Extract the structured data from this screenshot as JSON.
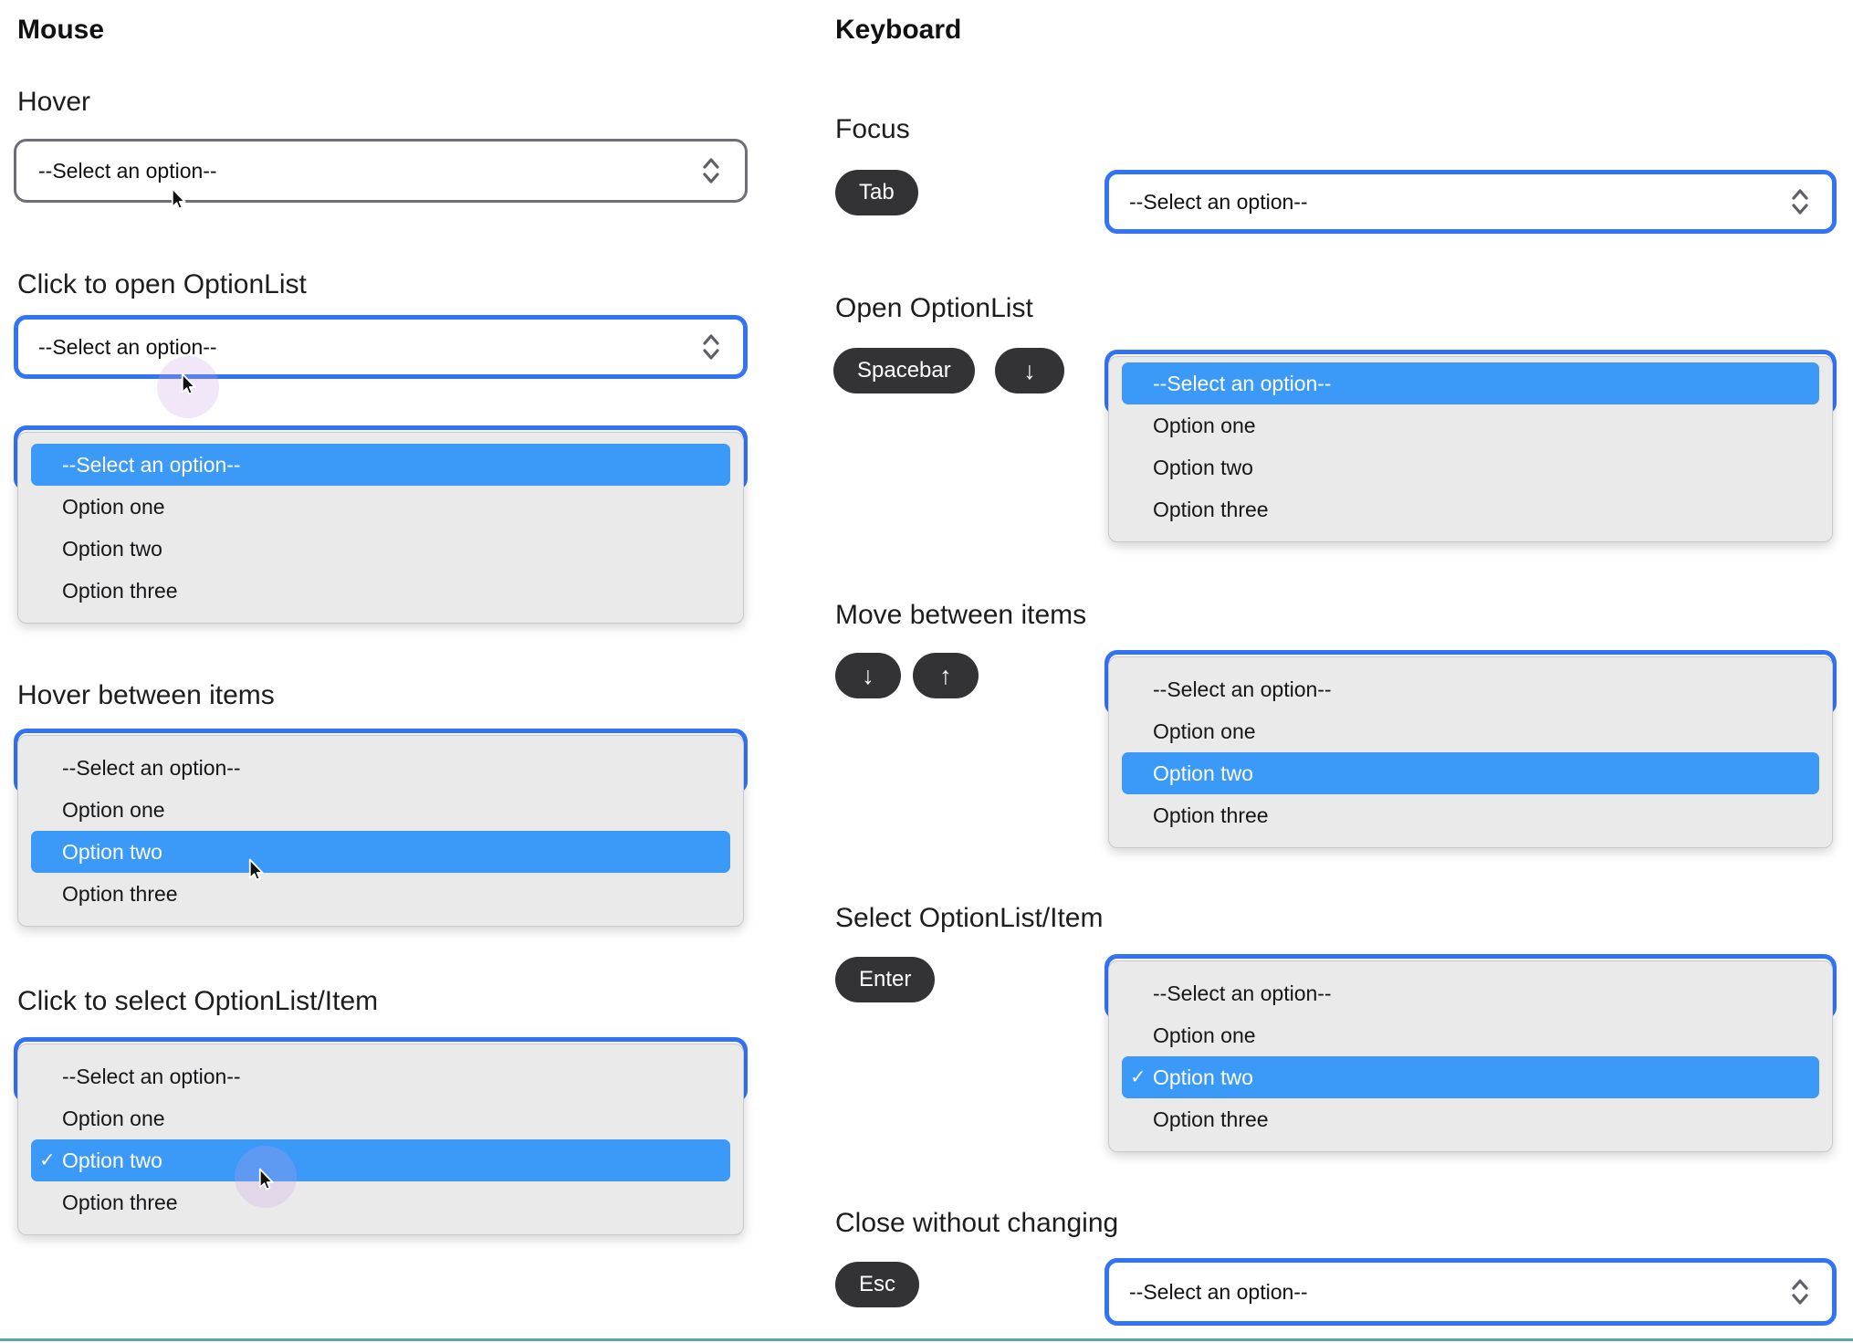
{
  "mouse": {
    "title": "Mouse",
    "hover_label": "Hover",
    "click_open_label": "Click to open OptionList",
    "hover_items_label": "Hover between items",
    "click_select_label": "Click to select OptionList/Item"
  },
  "keyboard": {
    "title": "Keyboard",
    "focus_label": "Focus",
    "open_label": "Open OptionList",
    "move_label": "Move between items",
    "select_label": "Select OptionList/Item",
    "close_label": "Close without changing",
    "keys": {
      "tab": "Tab",
      "spacebar": "Spacebar",
      "enter": "Enter",
      "esc": "Esc",
      "down_arrow": "↓",
      "up_arrow": "↑"
    }
  },
  "options": {
    "placeholder": "--Select an option--",
    "one": "Option one",
    "two": "Option two",
    "three": "Option three"
  },
  "icons": {
    "check": "✓",
    "select_chevron": "up-down-chevron-icon",
    "cursor": "mouse-pointer-icon"
  },
  "colors": {
    "focus_ring_blue": "#3374f6",
    "highlight_blue": "#3b99f7",
    "panel_gray": "#eaeaeb",
    "panel_border": "#c9c9cd",
    "select_border_gray": "#6e6e78",
    "key_pill_dark": "#333336",
    "click_halo_purple": "rgba(203,160,228,0.25)",
    "bottom_divider_teal": "#57a79f"
  }
}
